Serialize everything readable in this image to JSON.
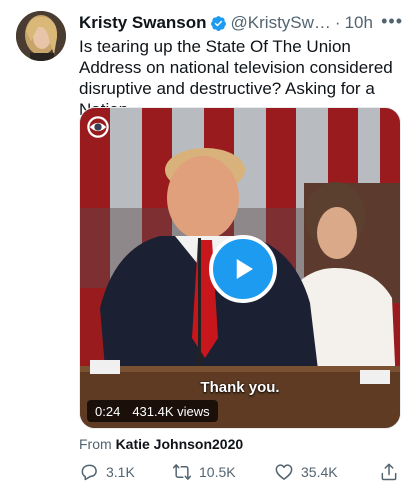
{
  "tweet": {
    "author_name": "Kristy Swanson",
    "handle": "@KristySw…",
    "separator": "·",
    "time": "10h",
    "more": "•••",
    "text": "Is tearing up the State Of The Union Address on national television considered disruptive and destructive? Asking for a Nation."
  },
  "media": {
    "caption": "Thank you.",
    "duration": "0:24",
    "views": "431.4K views"
  },
  "source": {
    "prefix": "From",
    "name": "Katie Johnson2020"
  },
  "actions": {
    "reply_count": "3.1K",
    "retweet_count": "10.5K",
    "like_count": "35.4K"
  },
  "colors": {
    "accent": "#1d9bf0",
    "secondary_text": "#536471"
  },
  "icons": [
    "verified-badge-icon",
    "more-icon",
    "cbs-eye-icon",
    "play-icon",
    "reply-icon",
    "retweet-icon",
    "like-icon",
    "share-icon"
  ]
}
